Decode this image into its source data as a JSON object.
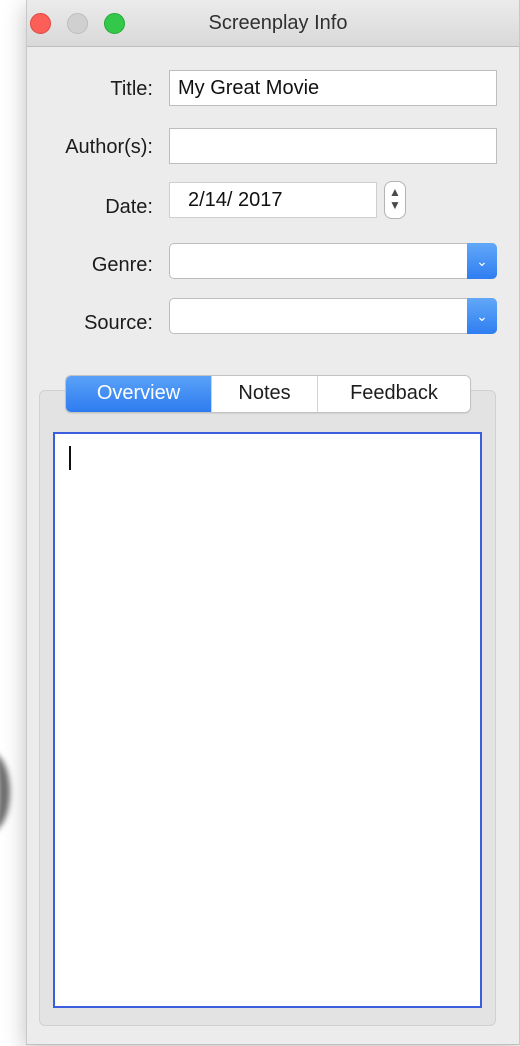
{
  "window": {
    "title": "Screenplay Info"
  },
  "form": {
    "title_label": "Title:",
    "title_value": "My Great Movie",
    "authors_label": "Author(s):",
    "authors_value": "",
    "date_label": "Date:",
    "date_value": "2/14/ 2017",
    "genre_label": "Genre:",
    "genre_value": "",
    "source_label": "Source:",
    "source_value": ""
  },
  "tabs": [
    {
      "label": "Overview",
      "selected": true
    },
    {
      "label": "Notes",
      "selected": false
    },
    {
      "label": "Feedback",
      "selected": false
    }
  ],
  "overview": {
    "text": ""
  },
  "icons": {
    "close": "close-icon",
    "minimize": "minimize-icon",
    "zoom": "zoom-icon",
    "stepper": "stepper-icon",
    "dropdown": "chevron-down-icon"
  },
  "colors": {
    "accent": "#2f7ef1",
    "focus_ring": "#3d5de0",
    "close": "#fc5f57",
    "zoom": "#34c84a"
  }
}
